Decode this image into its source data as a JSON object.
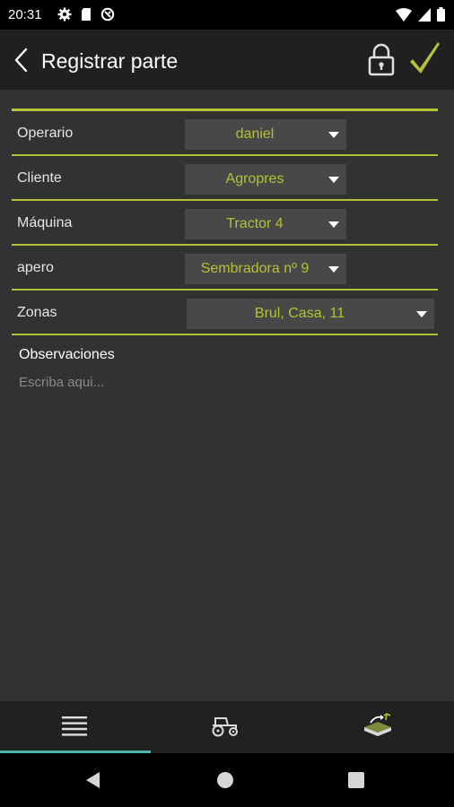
{
  "status_bar": {
    "time": "20:31",
    "left_icons": [
      "gear-icon",
      "sd-card-icon",
      "vpn-icon"
    ],
    "right_icons": [
      "wifi-icon",
      "signal-icon",
      "battery-icon"
    ]
  },
  "app_bar": {
    "title": "Registrar parte",
    "back_icon": "chevron-left-icon",
    "lock_icon": "lock-icon",
    "confirm_icon": "check-icon"
  },
  "form": {
    "rows": [
      {
        "label": "Operario",
        "value": "daniel"
      },
      {
        "label": "Cliente",
        "value": "Agropres"
      },
      {
        "label": "Máquina",
        "value": "Tractor 4"
      },
      {
        "label": "apero",
        "value": "Sembradora nº 9"
      },
      {
        "label": "Zonas",
        "value": "Brul, Casa, 11"
      }
    ],
    "observations": {
      "label": "Observaciones",
      "placeholder": "Escriba aqui...",
      "value": ""
    }
  },
  "bottom_tabs": [
    {
      "icon": "list-icon",
      "active": true
    },
    {
      "icon": "tractor-icon",
      "active": false
    },
    {
      "icon": "field-zone-icon",
      "active": false
    }
  ],
  "nav_bar": [
    "back-triangle-icon",
    "home-circle-icon",
    "recents-square-icon"
  ],
  "colors": {
    "accent": "#b5c234",
    "background": "#323232",
    "app_bar": "#202020",
    "dropdown": "#484848",
    "tab_indicator": "#4db6ac"
  }
}
